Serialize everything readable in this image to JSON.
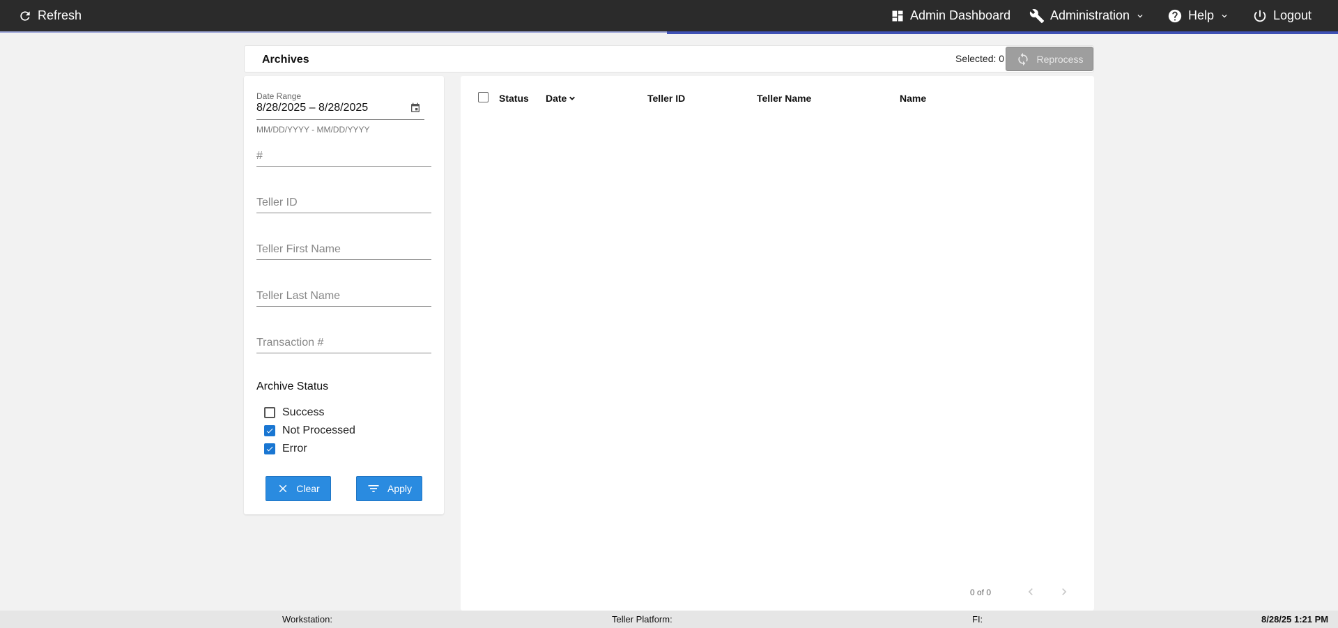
{
  "topbar": {
    "refresh_label": "Refresh",
    "admin_dashboard_label": "Admin Dashboard",
    "administration_label": "Administration",
    "help_label": "Help",
    "logout_label": "Logout",
    "accent_color": "#3f51b5"
  },
  "archives": {
    "title": "Archives",
    "selected_text": "Selected: 0",
    "reprocess_label": "Reprocess"
  },
  "filters": {
    "date_range_label": "Date Range",
    "date_range_value": "8/28/2025 – 8/28/2025",
    "date_range_hint": "MM/DD/YYYY - MM/DD/YYYY",
    "number_placeholder": "#",
    "teller_id_placeholder": "Teller ID",
    "teller_first_name_placeholder": "Teller First Name",
    "teller_last_name_placeholder": "Teller Last Name",
    "transaction_placeholder": "Transaction #",
    "archive_status_label": "Archive Status",
    "statuses": [
      {
        "label": "Success",
        "checked": false
      },
      {
        "label": "Not Processed",
        "checked": true
      },
      {
        "label": "Error",
        "checked": true
      }
    ],
    "clear_label": "Clear",
    "apply_label": "Apply",
    "button_color": "#2a8be0"
  },
  "grid": {
    "columns": [
      "Status",
      "Date",
      "Teller ID",
      "Teller Name",
      "Name"
    ],
    "sort_column": "Date",
    "pager_text": "0 of 0"
  },
  "footer": {
    "workstation_label": "Workstation:",
    "teller_platform_label": "Teller Platform:",
    "fi_label": "FI:",
    "datetime": "8/28/25 1:21 PM"
  }
}
